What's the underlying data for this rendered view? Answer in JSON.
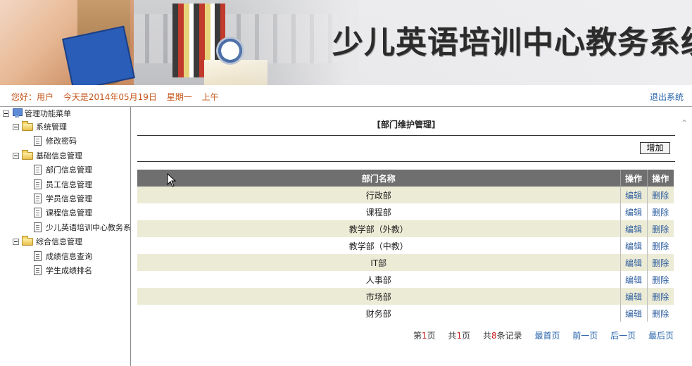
{
  "banner": {
    "title": "少儿英语培训中心教务系统"
  },
  "infobar": {
    "greeting": "您好：用户",
    "date_text": "今天是2014年05月19日",
    "weekday": "星期一",
    "period": "上午",
    "logout": "退出系统"
  },
  "sidebar": {
    "root": "管理功能菜单",
    "groups": [
      {
        "label": "系统管理",
        "items": [
          "修改密码"
        ]
      },
      {
        "label": "基础信息管理",
        "items": [
          "部门信息管理",
          "员工信息管理",
          "学员信息管理",
          "课程信息管理",
          "少儿英语培训中心教务系"
        ]
      },
      {
        "label": "综合信息管理",
        "items": [
          "成绩信息查询",
          "学生成绩排名"
        ]
      }
    ]
  },
  "main": {
    "section_title": "[部门维护管理]",
    "add_label": "增加",
    "table": {
      "headers": [
        "部门名称",
        "操作",
        "操作"
      ],
      "edit_label": "编辑",
      "delete_label": "删除",
      "rows": [
        "行政部",
        "课程部",
        "教学部（外教）",
        "教学部（中教）",
        "IT部",
        "人事部",
        "市场部",
        "财务部"
      ]
    },
    "pager": {
      "page_prefix": "第",
      "page_current": "1",
      "page_suffix": "页",
      "total_prefix": "共",
      "total_pages": "1",
      "total_suffix": "页",
      "records_prefix": "共",
      "records_count": "8",
      "records_suffix": "条记录",
      "first": "最首页",
      "prev": "前一页",
      "next": "后一页",
      "last": "最后页"
    }
  }
}
